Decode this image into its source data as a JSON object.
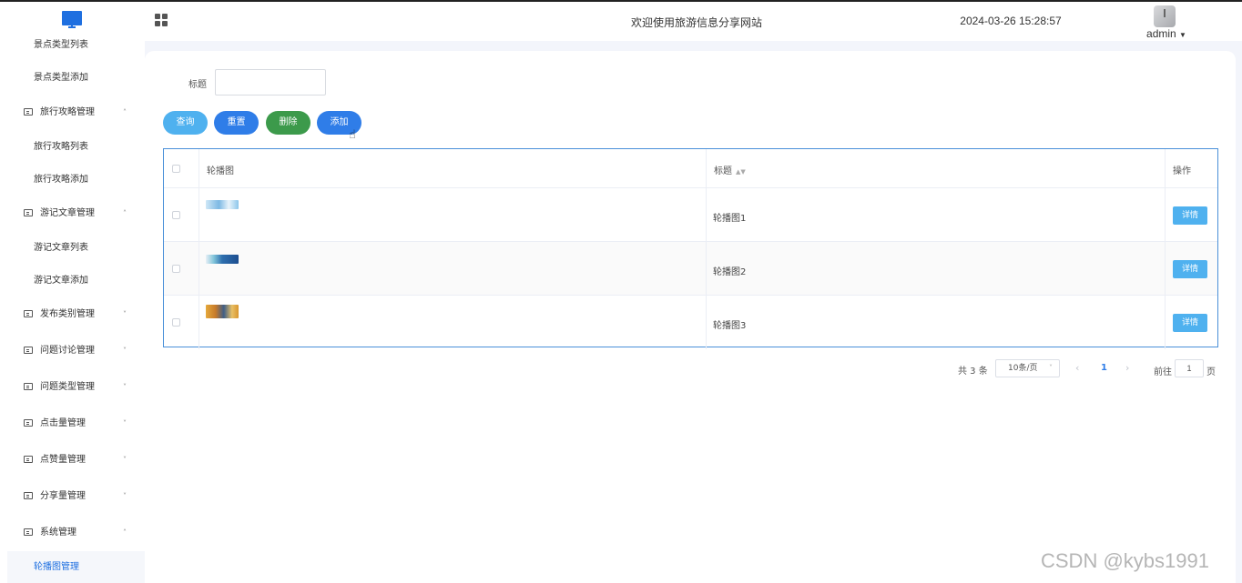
{
  "header": {
    "site_title": "欢迎使用旅游信息分享网站",
    "datetime": "2024-03-26 15:28:57",
    "user": "admin",
    "logo_icon": "monitor-icon",
    "menu_icon": "grid-icon"
  },
  "sidebar": {
    "items": [
      {
        "label": "景点类型列表",
        "type": "sub"
      },
      {
        "label": "景点类型添加",
        "type": "sub"
      },
      {
        "label": "旅行攻略管理",
        "type": "group",
        "expanded": true
      },
      {
        "label": "旅行攻略列表",
        "type": "sub"
      },
      {
        "label": "旅行攻略添加",
        "type": "sub"
      },
      {
        "label": "游记文章管理",
        "type": "group",
        "expanded": true
      },
      {
        "label": "游记文章列表",
        "type": "sub"
      },
      {
        "label": "游记文章添加",
        "type": "sub"
      },
      {
        "label": "发布类别管理",
        "type": "group",
        "expanded": false
      },
      {
        "label": "问题讨论管理",
        "type": "group",
        "expanded": false
      },
      {
        "label": "问题类型管理",
        "type": "group",
        "expanded": false
      },
      {
        "label": "点击量管理",
        "type": "group",
        "expanded": false
      },
      {
        "label": "点赞量管理",
        "type": "group",
        "expanded": false
      },
      {
        "label": "分享量管理",
        "type": "group",
        "expanded": false
      },
      {
        "label": "系统管理",
        "type": "group",
        "expanded": true
      },
      {
        "label": "轮播图管理",
        "type": "sub",
        "active": true
      }
    ],
    "arrow_up": "˄",
    "arrow_down": "˅"
  },
  "search": {
    "label": "标题",
    "value": "",
    "placeholder": ""
  },
  "actions": {
    "query": "查询",
    "reset": "重置",
    "delete": "删除",
    "add": "添加"
  },
  "table": {
    "headers": {
      "image": "轮播图",
      "title": "标题",
      "op": "操作"
    },
    "rows": [
      {
        "title": "轮播图1",
        "detail": "详情"
      },
      {
        "title": "轮播图2",
        "detail": "详情"
      },
      {
        "title": "轮播图3",
        "detail": "详情"
      }
    ]
  },
  "pagination": {
    "total": "共 3 条",
    "page_size": "10条/页",
    "current": "1",
    "goto_label": "前往",
    "goto_value": "1",
    "page_suffix": "页"
  },
  "watermark": "CSDN @kybs1991",
  "colors": {
    "accent": "#2f7de8",
    "query": "#4fb1ef",
    "delete": "#3c9a4b"
  }
}
